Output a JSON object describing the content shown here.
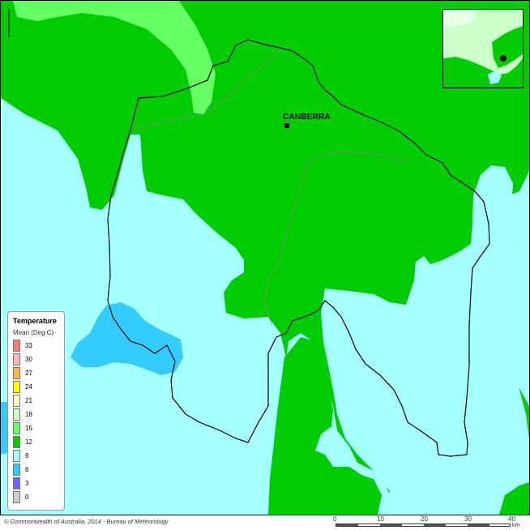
{
  "map": {
    "city_label": "CANBERRA"
  },
  "legend": {
    "title": "Temperature",
    "subtitle": "Mean (Deg C)",
    "items": [
      {
        "label": "33",
        "color": "#f08080"
      },
      {
        "label": "30",
        "color": "#ffb3b3"
      },
      {
        "label": "27",
        "color": "#ffb347"
      },
      {
        "label": "24",
        "color": "#ffff00"
      },
      {
        "label": "21",
        "color": "#ffffcc"
      },
      {
        "label": "18",
        "color": "#ccffcc"
      },
      {
        "label": "15",
        "color": "#66ff66"
      },
      {
        "label": "12",
        "color": "#00cc00"
      },
      {
        "label": "9",
        "color": "#a6ffff"
      },
      {
        "label": "6",
        "color": "#33ccff"
      },
      {
        "label": "3",
        "color": "#6666ff"
      },
      {
        "label": "0",
        "color": "#cccccc"
      }
    ]
  },
  "footer": {
    "copyright": "© Commonwealth of Australia, 2014 - Bureau of Meteorology",
    "scale_ticks": [
      "0",
      "10",
      "20",
      "30",
      "40"
    ],
    "scale_unit": "km"
  },
  "colors": {
    "band_12": "#00cc00",
    "band_15": "#66ff66",
    "band_9": "#a6ffff",
    "band_6": "#33ccff",
    "boundary": "#000000"
  }
}
